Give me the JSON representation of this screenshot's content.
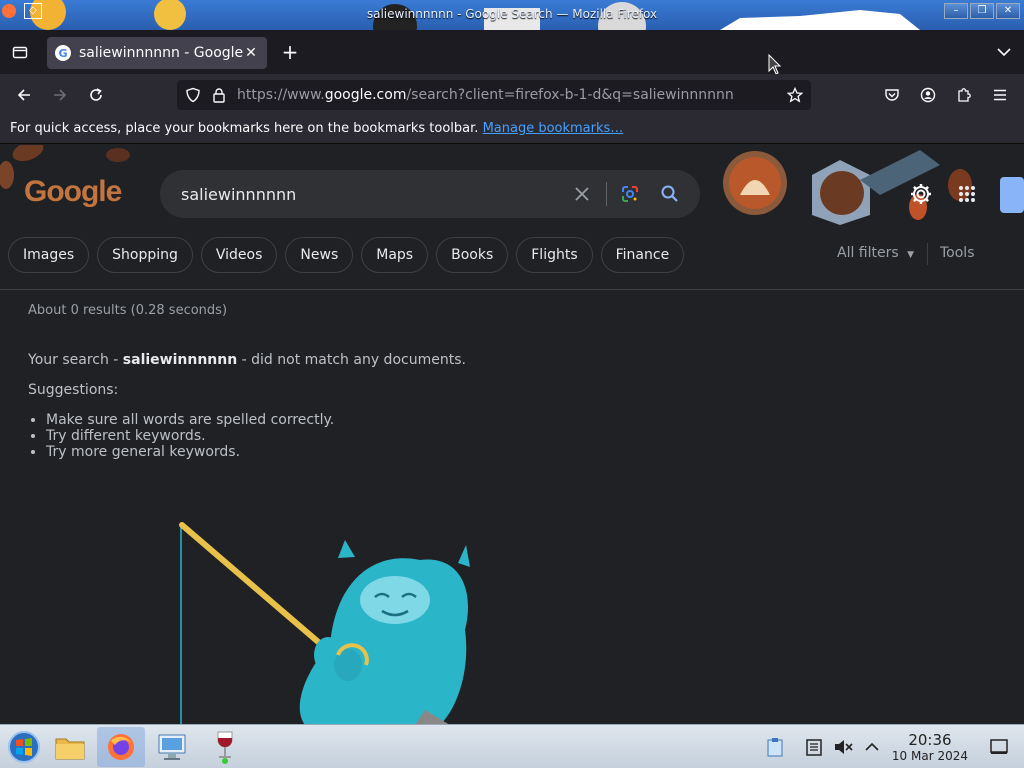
{
  "window": {
    "title": "saliewinnnnnn - Google Search — Mozilla Firefox"
  },
  "tabs": [
    {
      "label": "saliewinnnnnn - Google S",
      "favicon": "G"
    }
  ],
  "urlbar": {
    "prefix": "https://www.",
    "domain": "google.com",
    "suffix": "/search?client=firefox-b-1-d&q=saliewinnnnnn"
  },
  "bookmarks_bar": {
    "message": "For quick access, place your bookmarks here on the bookmarks toolbar. ",
    "link": "Manage bookmarks…"
  },
  "google": {
    "logo": "Google",
    "query": "saliewinnnnnn",
    "chips": [
      "Images",
      "Shopping",
      "Videos",
      "News",
      "Maps",
      "Books",
      "Flights",
      "Finance"
    ],
    "all_filters": "All filters",
    "tools": "Tools",
    "stats": "About 0 results (0.28 seconds)",
    "no_match_prefix": "Your search - ",
    "no_match_query": "saliewinnnnnn",
    "no_match_suffix": " - did not match any documents.",
    "suggestions_title": "Suggestions:",
    "suggestions": [
      "Make sure all words are spelled correctly.",
      "Try different keywords.",
      "Try more general keywords."
    ]
  },
  "taskbar": {
    "time": "20:36",
    "date": "10 Mar 2024"
  },
  "colors": {
    "page_bg": "#202124",
    "link": "#45a1ff",
    "mascot": "#2bb5c9"
  }
}
